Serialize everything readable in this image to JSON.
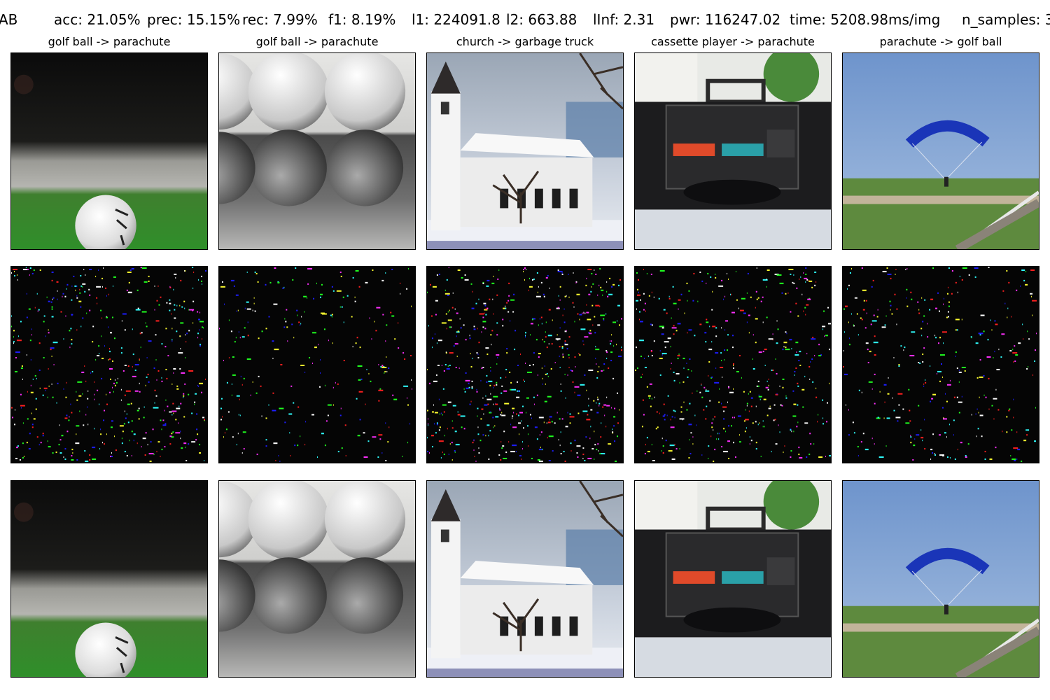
{
  "header": {
    "method": "AB",
    "acc": "acc: 21.05%",
    "prec": "prec: 15.15%",
    "rec": "rec: 7.99%",
    "f1": "f1: 8.19%",
    "l1": "l1: 224091.8",
    "l2": "l2: 663.88",
    "linf": "lInf: 2.31",
    "pwr": "pwr: 116247.02",
    "time": "time: 5208.98ms/img",
    "n_samples": "n_samples: 3"
  },
  "columns": [
    {
      "title": "golf ball -> parachute"
    },
    {
      "title": "golf ball -> parachute"
    },
    {
      "title": "church -> garbage truck"
    },
    {
      "title": "cassette player -> parachute"
    },
    {
      "title": "parachute -> golf ball"
    }
  ],
  "noise_colors": [
    "#1e1eff",
    "#ff2020",
    "#20ff20",
    "#ffff30",
    "#ff30ff",
    "#30ffff",
    "#ffffff"
  ]
}
